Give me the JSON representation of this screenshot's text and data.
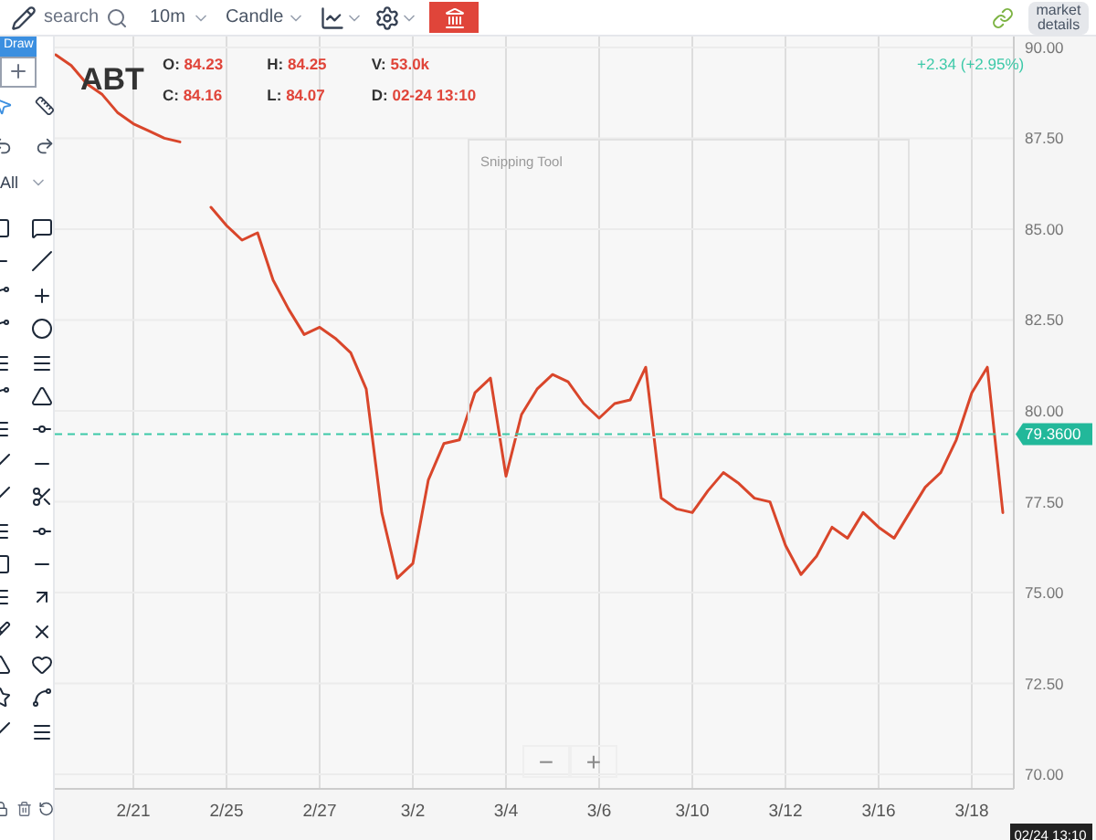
{
  "toolbar": {
    "search": {
      "placeholder": "search"
    },
    "interval": "10m",
    "chart_type": "Candle",
    "market_details": "market details"
  },
  "drawing_tools": {
    "label": "Draw",
    "filter": "All"
  },
  "quote": {
    "symbol": "ABT",
    "fields": [
      {
        "label": "O:",
        "value": "84.23"
      },
      {
        "label": "H:",
        "value": "84.25"
      },
      {
        "label": "V:",
        "value": "53.0k"
      },
      {
        "label": "C:",
        "value": "84.16"
      },
      {
        "label": "L:",
        "value": "84.07"
      },
      {
        "label": "D:",
        "value": "02-24 13:10"
      }
    ],
    "change": "+2.34 (+2.95%)"
  },
  "overlay": {
    "title": "Snipping Tool"
  },
  "zoom_controls": [
    "−",
    "+"
  ],
  "chart": {
    "last_price": "79.3600",
    "crosshair_time": "02/24 13:10",
    "chart_data": {
      "type": "line",
      "categories": [
        null,
        null,
        null,
        null,
        null,
        "2/21",
        null,
        null,
        null,
        null,
        null,
        "2/25",
        null,
        null,
        null,
        null,
        null,
        "2/27",
        null,
        null,
        null,
        null,
        null,
        "3/2",
        null,
        null,
        null,
        null,
        null,
        "3/4",
        null,
        null,
        null,
        null,
        null,
        "3/6",
        null,
        null,
        null,
        null,
        null,
        "3/10",
        null,
        null,
        null,
        null,
        null,
        "3/12",
        null,
        null,
        null,
        null,
        null,
        "3/16",
        null,
        null,
        null,
        null,
        null,
        "3/18",
        null,
        null
      ],
      "series": [
        {
          "color": "#d9462b",
          "values": [
            89.8,
            89.5,
            89,
            88.7,
            88.2,
            87.9,
            87.7,
            87.5,
            87.4,
            null,
            85.6,
            85.1,
            84.7,
            84.9,
            83.6,
            82.8,
            82.1,
            82.3,
            82.0,
            81.6,
            80.6,
            77.2,
            75.4,
            75.8,
            78.1,
            79.1,
            79.2,
            80.5,
            80.9,
            78.2,
            79.9,
            80.6,
            81.0,
            80.8,
            80.2,
            79.8,
            80.2,
            80.3,
            81.2,
            77.6,
            77.3,
            77.2,
            77.8,
            78.3,
            78.0,
            77.6,
            77.5,
            76.3,
            75.5,
            76.0,
            76.8,
            76.5,
            77.2,
            76.8,
            76.5,
            77.2,
            77.9,
            78.3,
            79.2,
            80.5,
            81.2,
            77.2
          ]
        }
      ],
      "ylim": [
        69.6,
        90.3
      ],
      "grid": true,
      "ref_lines": [
        {
          "axis": "y",
          "value": 79.36,
          "color": "#3cc9a8"
        }
      ],
      "yticks": [
        {
          "value": 70,
          "label": "70.00"
        },
        {
          "value": 72.5,
          "label": "72.50"
        },
        {
          "value": 75,
          "label": "75.00"
        },
        {
          "value": 77.5,
          "label": "77.50"
        },
        {
          "value": 80,
          "label": "80.00"
        },
        {
          "value": 82.5,
          "label": "82.50"
        },
        {
          "value": 85,
          "label": "85.00"
        },
        {
          "value": 87.5,
          "label": "87.50"
        },
        {
          "value": 90,
          "label": "90.00"
        }
      ]
    }
  }
}
